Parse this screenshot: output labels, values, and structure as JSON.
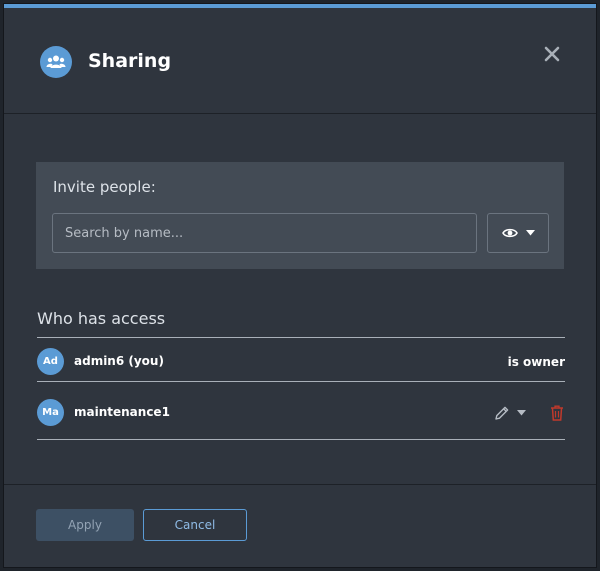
{
  "dialog": {
    "title": "Sharing",
    "icon": "users-icon",
    "close_icon": "close-icon"
  },
  "invite": {
    "label": "Invite people:",
    "search_placeholder": "Search by name...",
    "permission_icon": "eye-icon",
    "permission_dropdown_icon": "caret-down-icon"
  },
  "access": {
    "section_title": "Who has access",
    "users": [
      {
        "initials": "Ad",
        "name": "admin6 (you)",
        "role_text": "is owner"
      },
      {
        "initials": "Ma",
        "name": "maintenance1",
        "permission_icon": "pencil-icon",
        "dropdown_icon": "caret-down-icon",
        "remove_icon": "trash-icon"
      }
    ]
  },
  "footer": {
    "apply_label": "Apply",
    "cancel_label": "Cancel"
  },
  "colors": {
    "accent": "#5b9bd5",
    "modal_bg": "#2f353e",
    "panel_bg": "#434b55",
    "danger": "#c0392b"
  }
}
